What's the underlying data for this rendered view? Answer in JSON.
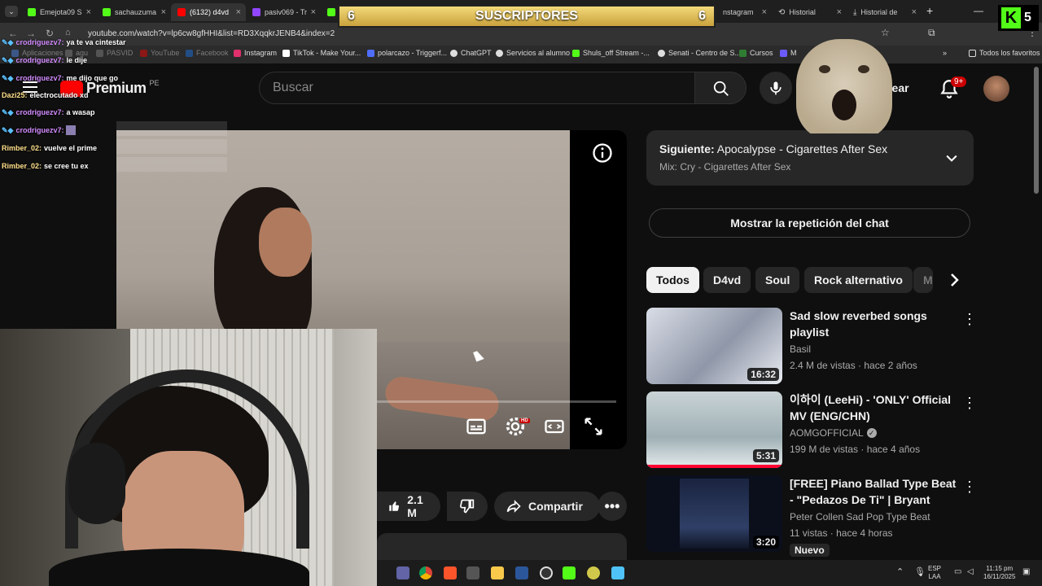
{
  "browser": {
    "tabs": [
      {
        "label": "Emejota09 S",
        "color": "#53fc18"
      },
      {
        "label": "sachauzuma",
        "color": "#53fc18"
      },
      {
        "label": "(6132) d4vd",
        "color": "#ff0000"
      },
      {
        "label": "pasiv069 - Tr",
        "color": "#9146ff"
      },
      {
        "label": "",
        "color": "#53fc18"
      },
      {
        "label": "nstagram",
        "color": "#e1306c"
      },
      {
        "label": "Historial",
        "color": "#888888"
      },
      {
        "label": "Historial de",
        "color": "#888888"
      }
    ],
    "new_tab": "+",
    "url": "youtube.com/watch?v=lp6cw8gfHHI&list=RD3XqqkrJENB4&index=2",
    "bookmarks": [
      {
        "label": "Aplicaciones",
        "color": "#4f8ef7"
      },
      {
        "label": "agu",
        "color": "#888888"
      },
      {
        "label": "PASVID",
        "color": "#888888"
      },
      {
        "label": "YouTube",
        "color": "#ff0000"
      },
      {
        "label": "Facebook",
        "color": "#1877f2"
      },
      {
        "label": "Instagram",
        "color": "#e1306c"
      },
      {
        "label": "TikTok - Make Your...",
        "color": "#ffffff"
      },
      {
        "label": "polarcazo - Triggerf...",
        "color": "#4f6df7"
      },
      {
        "label": "ChatGPT",
        "color": "#dddddd"
      },
      {
        "label": "Servicios al alumno",
        "color": "#dddddd"
      },
      {
        "label": "Shuls_off Stream -...",
        "color": "#53fc18"
      },
      {
        "label": "Senati - Centro de S...",
        "color": "#dddddd"
      },
      {
        "label": "Cursos",
        "color": "#2e7d32"
      },
      {
        "label": "M",
        "color": "#6b5bff"
      }
    ],
    "favorites": "Todos los favoritos"
  },
  "overlay": {
    "subs_left": "6",
    "subs_label": "SUSCRIPTORES",
    "subs_right": "6",
    "kick_count": "5"
  },
  "chat": [
    {
      "user": "crodriguezv7:",
      "text": "ya te va cintestar",
      "style": "u"
    },
    {
      "user": "crodriguezv7:",
      "text": "le dije",
      "style": "u"
    },
    {
      "user": "crodriguezv7:",
      "text": "me dijo que go",
      "style": "u"
    },
    {
      "user": "Dazi25:",
      "text": "electrocutado xd",
      "style": "u2"
    },
    {
      "user": "crodriguezv7:",
      "text": "a wasap",
      "style": "u"
    },
    {
      "user": "crodriguezv7:",
      "text": "",
      "style": "u"
    },
    {
      "user": "Rimber_02:",
      "text": "vuelve el prime",
      "style": "u2"
    },
    {
      "user": "Rimber_02:",
      "text": "se cree tu ex",
      "style": "u2"
    }
  ],
  "youtube": {
    "logo_text": "Premium",
    "logo_suffix": "PE",
    "search_placeholder": "Buscar",
    "create_label": "Crear",
    "notif_badge": "9+",
    "next": {
      "prefix": "Siguiente:",
      "title": "Apocalypse - Cigarettes After Sex",
      "mix": "Mix: Cry - Cigarettes After Sex"
    },
    "chat_replay": "Mostrar la repetición del chat",
    "chips": [
      "Todos",
      "D4vd",
      "Soul",
      "Rock alternativo",
      "M"
    ],
    "recommendations": [
      {
        "title": "Sad slow reverbed songs playlist",
        "channel": "Basil",
        "meta": "2.4 M de vistas · hace 2 años",
        "duration": "16:32",
        "verified": false,
        "badge": ""
      },
      {
        "title": "이하이 (LeeHi) - 'ONLY' Official MV (ENG/CHN)",
        "channel": "AOMGOFFICIAL",
        "meta": "199 M de vistas · hace 4 años",
        "duration": "5:31",
        "verified": true,
        "badge": ""
      },
      {
        "title": "[FREE] Piano Ballad Type Beat - \"Pedazos De Ti\" | Bryant Barne...",
        "channel": "Peter Collen Sad Pop Type Beat",
        "meta": "11 vistas · hace 4 horas",
        "duration": "3:20",
        "verified": false,
        "badge": "Nuevo"
      }
    ],
    "likes": "2.1 M",
    "share": "Compartir",
    "hd_badge": "HD"
  },
  "taskbar": {
    "lang_top": "ESP",
    "lang_bottom": "LAA",
    "time": "11:15 pm",
    "date": "16/11/2025"
  },
  "colors": {
    "yt_red": "#ff0000",
    "kick_green": "#53fc18",
    "subs_gold": "#e2c25c",
    "badge_red": "#cc0000"
  }
}
